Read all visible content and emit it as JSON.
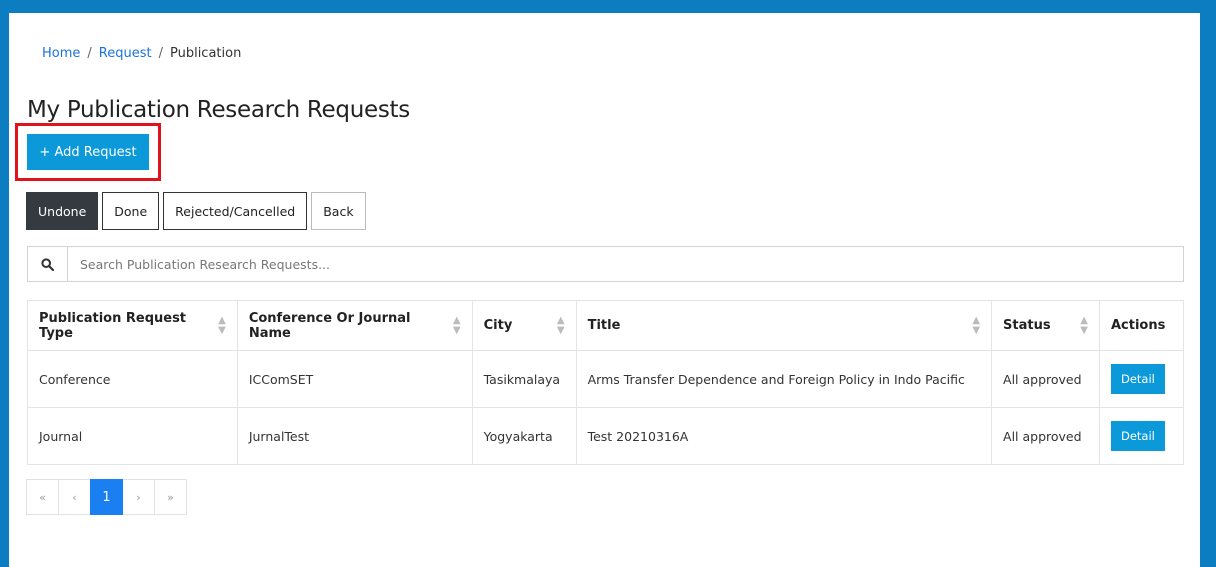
{
  "breadcrumb": {
    "home": "Home",
    "request": "Request",
    "current": "Publication",
    "separator": "/"
  },
  "page_title": "My Publication Research Requests",
  "add_button": {
    "label": "+ Add Request"
  },
  "filters": {
    "undone": "Undone",
    "done": "Done",
    "rejected": "Rejected/Cancelled",
    "back": "Back",
    "active": "Undone"
  },
  "search": {
    "placeholder": "Search Publication Research Requests..."
  },
  "table": {
    "headers": [
      "Publication Request Type",
      "Conference Or Journal Name",
      "City",
      "Title",
      "Status",
      "Actions"
    ],
    "rows": [
      {
        "type": "Conference",
        "name": "ICComSET",
        "city": "Tasikmalaya",
        "title": "Arms Transfer Dependence and Foreign Policy in Indo Pacific",
        "status": "All approved",
        "action": "Detail"
      },
      {
        "type": "Journal",
        "name": "JurnalTest",
        "city": "Yogyakarta",
        "title": "Test 20210316A",
        "status": "All approved",
        "action": "Detail"
      }
    ]
  },
  "pagination": {
    "first": "«",
    "prev": "‹",
    "current": "1",
    "next": "›",
    "last": "»"
  },
  "colors": {
    "accent": "#0b99d9",
    "frame": "#0d7dc2",
    "highlight": "#e0121a",
    "active_page": "#1a7ff0"
  }
}
